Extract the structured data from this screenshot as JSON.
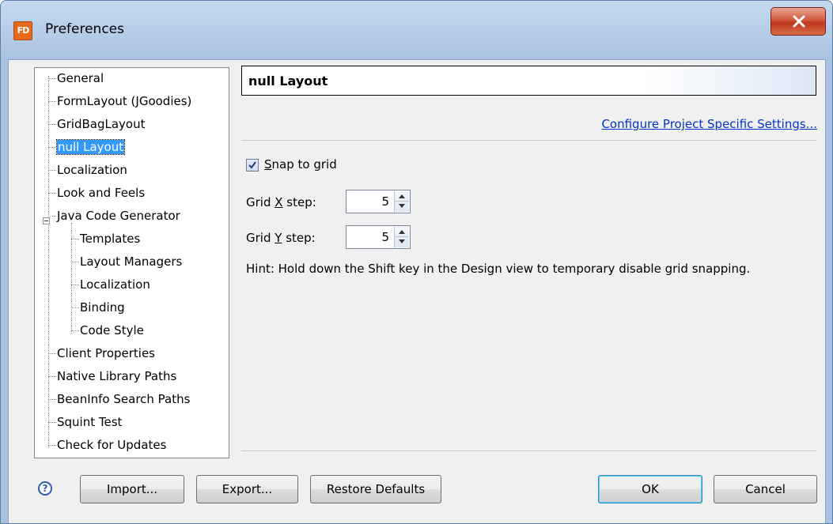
{
  "window": {
    "title": "Preferences",
    "app_icon_text": "FD",
    "app_icon": "formdesigner-logo-icon",
    "close_icon": "close-icon"
  },
  "tree": {
    "items": [
      {
        "label": "General"
      },
      {
        "label": "FormLayout (JGoodies)"
      },
      {
        "label": "GridBagLayout"
      },
      {
        "label": "null Layout",
        "selected": true
      },
      {
        "label": "Localization"
      },
      {
        "label": "Look and Feels"
      },
      {
        "label": "Java Code Generator",
        "expanded": true
      },
      {
        "label": "Templates",
        "child": true
      },
      {
        "label": "Layout Managers",
        "child": true
      },
      {
        "label": "Localization",
        "child": true
      },
      {
        "label": "Binding",
        "child": true
      },
      {
        "label": "Code Style",
        "child": true
      },
      {
        "label": "Client Properties"
      },
      {
        "label": "Native Library Paths"
      },
      {
        "label": "BeanInfo Search Paths"
      },
      {
        "label": "Squint Test"
      },
      {
        "label": "Check for Updates"
      }
    ]
  },
  "panel": {
    "title": "null Layout",
    "project_link": "Configure Project Specific Settings...",
    "snap": {
      "label_mnemonic": "S",
      "label_rest": "nap to grid",
      "checked": true
    },
    "grid_x": {
      "label_pre": "Grid ",
      "label_mnemonic": "X",
      "label_post": " step:",
      "value": "5"
    },
    "grid_y": {
      "label_pre": "Grid ",
      "label_mnemonic": "Y",
      "label_post": " step:",
      "value": "5"
    },
    "hint": "Hint: Hold down the Shift key in the Design view to temporary disable grid snapping."
  },
  "buttons": {
    "help": "?",
    "import": "Import...",
    "export": "Export...",
    "restore": "Restore Defaults",
    "ok": "OK",
    "cancel": "Cancel"
  },
  "colors": {
    "selection": "#3399ff",
    "link": "#0033cc",
    "close_button": "#c0371d"
  }
}
